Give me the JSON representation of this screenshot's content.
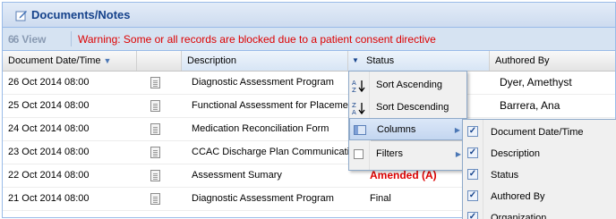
{
  "panel": {
    "title": "Documents/Notes",
    "title_icon": "edit-document-icon"
  },
  "toolbar": {
    "view_label": "View",
    "view_icon": "binoculars-icon",
    "warning": "Warning: Some or all records are blocked due to a patient consent directive"
  },
  "columns": {
    "date": "Document Date/Time",
    "description": "Description",
    "status": "Status",
    "authored_by": "Authored By"
  },
  "rows": [
    {
      "date": "26 Oct 2014 08:00",
      "description": "Diagnostic Assessment Program",
      "status": "",
      "author": "Dyer, Amethyst"
    },
    {
      "date": "25 Oct 2014 08:00",
      "description": "Functional Assessment for Placement",
      "status": "",
      "author": "Barrera, Ana"
    },
    {
      "date": "24 Oct 2014 08:00",
      "description": "Medication Reconciliation Form",
      "status": "",
      "author": ""
    },
    {
      "date": "23 Oct 2014 08:00",
      "description": "CCAC Discharge Plan Communication",
      "status": "",
      "author": ""
    },
    {
      "date": "22 Oct 2014 08:00",
      "description": "Assessment Sumary",
      "status": "Amended (A)",
      "author": ""
    },
    {
      "date": "21 Oct 2014 08:00",
      "description": "Diagnostic Assessment Program",
      "status": "Final",
      "author": ""
    }
  ],
  "column_menu": {
    "items": [
      {
        "label": "Sort Ascending",
        "icon": "sort-ascending-icon"
      },
      {
        "label": "Sort Descending",
        "icon": "sort-descending-icon"
      },
      {
        "label": "Columns",
        "icon": "columns-icon"
      },
      {
        "label": "Filters",
        "icon": "filter-checkbox-icon"
      }
    ]
  },
  "columns_submenu": {
    "items": [
      {
        "label": "Document Date/Time",
        "checked": true
      },
      {
        "label": "Description",
        "checked": true
      },
      {
        "label": "Status",
        "checked": true
      },
      {
        "label": "Authored By",
        "checked": true
      },
      {
        "label": "Organization",
        "checked": true
      }
    ]
  },
  "colors": {
    "warning": "#dd0000",
    "header_blue": "#15428b",
    "amended": "#dd0000"
  }
}
